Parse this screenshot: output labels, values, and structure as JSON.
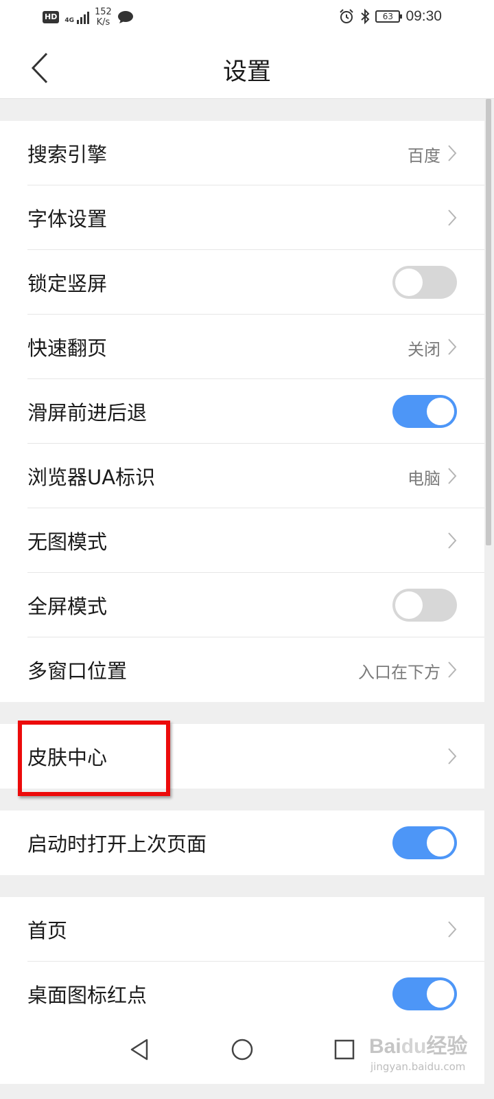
{
  "status_bar": {
    "hd": "HD",
    "network": "4G",
    "speed_value": "152",
    "speed_unit": "K/s",
    "battery": "63",
    "time": "09:30"
  },
  "header": {
    "title": "设置"
  },
  "settings": {
    "search_engine": {
      "label": "搜索引擎",
      "value": "百度"
    },
    "font_settings": {
      "label": "字体设置"
    },
    "lock_portrait": {
      "label": "锁定竖屏",
      "enabled": false
    },
    "fast_page_turn": {
      "label": "快速翻页",
      "value": "关闭"
    },
    "swipe_navigation": {
      "label": "滑屏前进后退",
      "enabled": true
    },
    "browser_ua": {
      "label": "浏览器UA标识",
      "value": "电脑"
    },
    "no_image_mode": {
      "label": "无图模式"
    },
    "fullscreen_mode": {
      "label": "全屏模式",
      "enabled": false
    },
    "multi_window_position": {
      "label": "多窗口位置",
      "value": "入口在下方"
    },
    "skin_center": {
      "label": "皮肤中心"
    },
    "restore_last_page": {
      "label": "启动时打开上次页面",
      "enabled": true
    },
    "home_page": {
      "label": "首页"
    },
    "desktop_icon_badge": {
      "label": "桌面图标红点",
      "enabled": true
    }
  },
  "colors": {
    "toggle_on": "#4d96f7",
    "toggle_off": "#d7d7d7",
    "highlight": "#ec0b0b"
  },
  "watermark": {
    "logo_bai": "Bai",
    "logo_du": "du",
    "logo_jingyan": "经验",
    "sub": "jingyan.baidu.com"
  }
}
